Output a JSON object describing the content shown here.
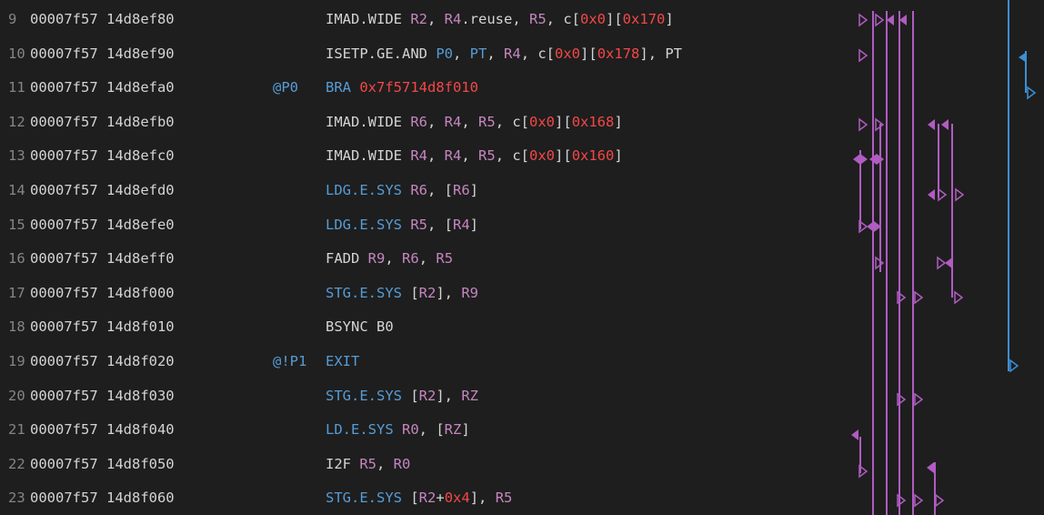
{
  "colors": {
    "background": "#1e1e1e",
    "line_number": "#858585",
    "address": "#d4d4d4",
    "plain": "#d4d4d4",
    "register": "#c586c0",
    "predicate": "#569cd6",
    "constant": "#f44747",
    "memory_op": "#569cd6",
    "arrow_purple": "#b05cc2",
    "arrow_blue": "#3c8fd4"
  },
  "rows": [
    {
      "line": "9",
      "address": "00007f57 14d8ef80",
      "predicate": "",
      "tokens": [
        [
          "IMAD.WIDE ",
          "plain"
        ],
        [
          "R2",
          "reg"
        ],
        [
          ", ",
          "plain"
        ],
        [
          "R4",
          "reg"
        ],
        [
          ".reuse, ",
          "plain"
        ],
        [
          "R5",
          "reg"
        ],
        [
          ", c[",
          "plain"
        ],
        [
          "0x0",
          "const"
        ],
        [
          "][",
          "plain"
        ],
        [
          "0x170",
          "const"
        ],
        [
          "]",
          "plain"
        ]
      ]
    },
    {
      "line": "10",
      "address": "00007f57 14d8ef90",
      "predicate": "",
      "tokens": [
        [
          "ISETP.GE.AND ",
          "plain"
        ],
        [
          "P0",
          "pred"
        ],
        [
          ", ",
          "plain"
        ],
        [
          "PT",
          "pred"
        ],
        [
          ", ",
          "plain"
        ],
        [
          "R4",
          "reg"
        ],
        [
          ", c[",
          "plain"
        ],
        [
          "0x0",
          "const"
        ],
        [
          "][",
          "plain"
        ],
        [
          "0x178",
          "const"
        ],
        [
          "], PT",
          "plain"
        ]
      ]
    },
    {
      "line": "11",
      "address": "00007f57 14d8efa0",
      "predicate": "@P0",
      "tokens": [
        [
          "BRA ",
          "mem"
        ],
        [
          "0x7f5714d8f010",
          "const"
        ]
      ]
    },
    {
      "line": "12",
      "address": "00007f57 14d8efb0",
      "predicate": "",
      "tokens": [
        [
          "IMAD.WIDE ",
          "plain"
        ],
        [
          "R6",
          "reg"
        ],
        [
          ", ",
          "plain"
        ],
        [
          "R4",
          "reg"
        ],
        [
          ", ",
          "plain"
        ],
        [
          "R5",
          "reg"
        ],
        [
          ", c[",
          "plain"
        ],
        [
          "0x0",
          "const"
        ],
        [
          "][",
          "plain"
        ],
        [
          "0x168",
          "const"
        ],
        [
          "]",
          "plain"
        ]
      ]
    },
    {
      "line": "13",
      "address": "00007f57 14d8efc0",
      "predicate": "",
      "tokens": [
        [
          "IMAD.WIDE ",
          "plain"
        ],
        [
          "R4",
          "reg"
        ],
        [
          ", ",
          "plain"
        ],
        [
          "R4",
          "reg"
        ],
        [
          ", ",
          "plain"
        ],
        [
          "R5",
          "reg"
        ],
        [
          ", c[",
          "plain"
        ],
        [
          "0x0",
          "const"
        ],
        [
          "][",
          "plain"
        ],
        [
          "0x160",
          "const"
        ],
        [
          "]",
          "plain"
        ]
      ]
    },
    {
      "line": "14",
      "address": "00007f57 14d8efd0",
      "predicate": "",
      "tokens": [
        [
          "LDG.E.SYS ",
          "mem"
        ],
        [
          "R6",
          "reg"
        ],
        [
          ", [",
          "plain"
        ],
        [
          "R6",
          "reg"
        ],
        [
          "]",
          "plain"
        ]
      ]
    },
    {
      "line": "15",
      "address": "00007f57 14d8efe0",
      "predicate": "",
      "tokens": [
        [
          "LDG.E.SYS ",
          "mem"
        ],
        [
          "R5",
          "reg"
        ],
        [
          ", [",
          "plain"
        ],
        [
          "R4",
          "reg"
        ],
        [
          "]",
          "plain"
        ]
      ]
    },
    {
      "line": "16",
      "address": "00007f57 14d8eff0",
      "predicate": "",
      "tokens": [
        [
          "FADD ",
          "plain"
        ],
        [
          "R9",
          "reg"
        ],
        [
          ", ",
          "plain"
        ],
        [
          "R6",
          "reg"
        ],
        [
          ", ",
          "plain"
        ],
        [
          "R5",
          "reg"
        ]
      ]
    },
    {
      "line": "17",
      "address": "00007f57 14d8f000",
      "predicate": "",
      "tokens": [
        [
          "STG.E.SYS ",
          "mem"
        ],
        [
          "[",
          "plain"
        ],
        [
          "R2",
          "reg"
        ],
        [
          "], ",
          "plain"
        ],
        [
          "R9",
          "reg"
        ]
      ]
    },
    {
      "line": "18",
      "address": "00007f57 14d8f010",
      "predicate": "",
      "tokens": [
        [
          "BSYNC B0",
          "plain"
        ]
      ]
    },
    {
      "line": "19",
      "address": "00007f57 14d8f020",
      "predicate": "@!P1",
      "tokens": [
        [
          "EXIT",
          "mem"
        ]
      ]
    },
    {
      "line": "20",
      "address": "00007f57 14d8f030",
      "predicate": "",
      "tokens": [
        [
          "STG.E.SYS ",
          "mem"
        ],
        [
          "[",
          "plain"
        ],
        [
          "R2",
          "reg"
        ],
        [
          "], ",
          "plain"
        ],
        [
          "RZ",
          "reg"
        ]
      ]
    },
    {
      "line": "21",
      "address": "00007f57 14d8f040",
      "predicate": "",
      "tokens": [
        [
          "LD.E.SYS ",
          "mem"
        ],
        [
          "R0",
          "reg"
        ],
        [
          ", [",
          "plain"
        ],
        [
          "RZ",
          "reg"
        ],
        [
          "]",
          "plain"
        ]
      ]
    },
    {
      "line": "22",
      "address": "00007f57 14d8f050",
      "predicate": "",
      "tokens": [
        [
          "I2F ",
          "plain"
        ],
        [
          "R5",
          "reg"
        ],
        [
          ", ",
          "plain"
        ],
        [
          "R0",
          "reg"
        ]
      ]
    },
    {
      "line": "23",
      "address": "00007f57 14d8f060",
      "predicate": "",
      "tokens": [
        [
          "STG.E.SYS ",
          "mem"
        ],
        [
          "[",
          "plain"
        ],
        [
          "R2",
          "reg"
        ],
        [
          "+",
          "plain"
        ],
        [
          "0x4",
          "const"
        ],
        [
          "], ",
          "plain"
        ],
        [
          "R5",
          "reg"
        ]
      ]
    }
  ]
}
